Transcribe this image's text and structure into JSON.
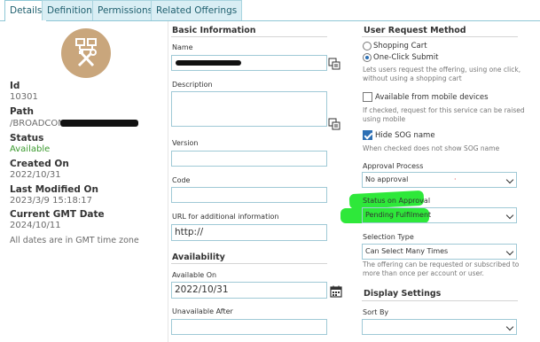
{
  "tabs": [
    "Details",
    "Definition",
    "Permissions",
    "Related Offerings"
  ],
  "left": {
    "id_label": "Id",
    "id_value": "10301",
    "path_label": "Path",
    "path_value": "/BROADCOMA",
    "status_label": "Status",
    "status_value": "Available",
    "created_label": "Created On",
    "created_value": "2022/10/31",
    "modified_label": "Last Modified On",
    "modified_value": "2023/3/9 15:18:17",
    "gmt_label": "Current GMT Date",
    "gmt_value": "2024/10/11",
    "note": "All dates are in GMT time zone",
    "avatar_icon": "tools-icon",
    "avatar_color": "#c9a67c"
  },
  "basic": {
    "title": "Basic Information",
    "name_label": "Name",
    "description_label": "Description",
    "version_label": "Version",
    "code_label": "Code",
    "url_label": "URL for additional information",
    "url_value": "http://"
  },
  "availability": {
    "title": "Availability",
    "available_on_label": "Available On",
    "available_on_value": "2022/10/31",
    "unavailable_after_label": "Unavailable After"
  },
  "request": {
    "title": "User Request Method",
    "opt_cart": "Shopping Cart",
    "opt_one_click": "One-Click Submit",
    "one_click_help_1": "Lets users request the offering, using one click,",
    "one_click_help_2": "without using a shopping cart",
    "mobile_label": "Available from mobile devices",
    "mobile_help_1": "If checked, request for this service can be raised",
    "mobile_help_2": "using mobile",
    "hide_sog_label": "Hide SOG name",
    "hide_sog_help": "When checked does not show SOG name",
    "approval_label": "Approval Process",
    "approval_value": "No approval",
    "status_approval_label": "Status on Approval",
    "status_approval_value": "Pending Fulfilment",
    "selection_label": "Selection Type",
    "selection_value": "Can Select Many Times",
    "selection_help_1": "The offering can be requested or subscribed to",
    "selection_help_2": "more than once per account or user.",
    "highlight_color": "#2ee83a"
  },
  "display": {
    "title": "Display Settings",
    "sort_by_label": "Sort By"
  }
}
